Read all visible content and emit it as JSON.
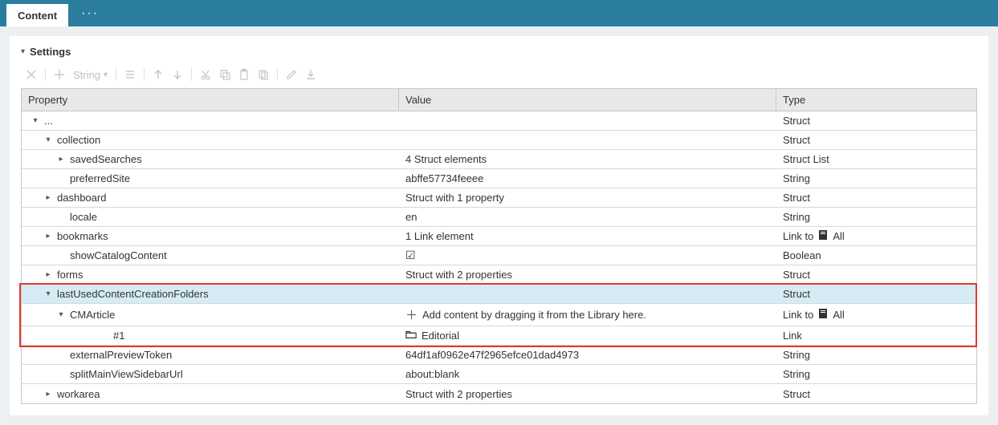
{
  "topbar": {
    "tab_label": "Content"
  },
  "section": {
    "title": "Settings"
  },
  "toolbar": {
    "type_label": "String"
  },
  "columns": {
    "property": "Property",
    "value": "Value",
    "type": "Type"
  },
  "rows": [
    {
      "indent": 0,
      "exp": "down",
      "prop": "...",
      "val": "",
      "type": "Struct"
    },
    {
      "indent": 1,
      "exp": "down",
      "prop": "collection",
      "val": "",
      "type": "Struct"
    },
    {
      "indent": 2,
      "exp": "right",
      "prop": "savedSearches",
      "val": "4 Struct elements",
      "type": "Struct List"
    },
    {
      "indent": 2,
      "exp": "",
      "prop": "preferredSite",
      "val": "abffe57734feeee",
      "type": "String"
    },
    {
      "indent": 1,
      "exp": "right",
      "prop": "dashboard",
      "val": "Struct with 1 property",
      "type": "Struct"
    },
    {
      "indent": 2,
      "exp": "",
      "prop": "locale",
      "val": "en",
      "type": "String"
    },
    {
      "indent": 1,
      "exp": "right",
      "prop": "bookmarks",
      "val": "1 Link element",
      "type_prefix": "Link to",
      "type_suffix": "All",
      "type_icon": "link"
    },
    {
      "indent": 2,
      "exp": "",
      "prop": "showCatalogContent",
      "val_icon": "check",
      "type": "Boolean"
    },
    {
      "indent": 1,
      "exp": "right",
      "prop": "forms",
      "val": "Struct with 2 properties",
      "type": "Struct"
    },
    {
      "indent": 1,
      "exp": "down",
      "prop": "lastUsedContentCreationFolders",
      "val": "",
      "type": "Struct",
      "selected": true
    },
    {
      "indent": 2,
      "exp": "down",
      "prop": "CMArticle",
      "val_icon": "plus",
      "val": "Add content by dragging it from the Library here.",
      "type_prefix": "Link to",
      "type_suffix": "All",
      "type_icon": "link"
    },
    {
      "indent": 4,
      "exp": "",
      "prop": "#1",
      "val_icon": "folder",
      "val": "Editorial",
      "type": "Link"
    },
    {
      "indent": 2,
      "exp": "",
      "prop": "externalPreviewToken",
      "val": "64df1af0962e47f2965efce01dad4973",
      "type": "String"
    },
    {
      "indent": 2,
      "exp": "",
      "prop": "splitMainViewSidebarUrl",
      "val": "about:blank",
      "type": "String"
    },
    {
      "indent": 1,
      "exp": "right",
      "prop": "workarea",
      "val": "Struct with 2 properties",
      "type": "Struct"
    }
  ]
}
